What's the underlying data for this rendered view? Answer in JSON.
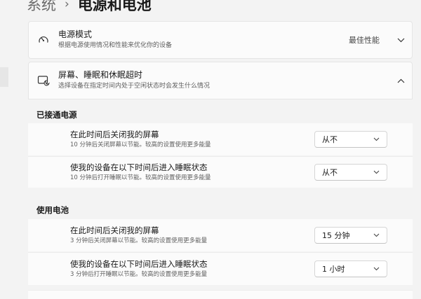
{
  "breadcrumb": {
    "parent": "系统",
    "separator": "›",
    "current": "电源和电池"
  },
  "power_mode": {
    "icon": "power-mode-gauge-icon",
    "title": "电源模式",
    "subtitle": "根据电源使用情况和性能来优化你的设备",
    "value": "最佳性能",
    "expanded": false
  },
  "screen_sleep": {
    "icon": "screen-sleep-icon",
    "title": "屏幕、睡眠和休眠超时",
    "subtitle": "选择设备在指定时间内处于空闲状态时会发生什么情况",
    "expanded": true,
    "plugged_in": {
      "label": "已接通电源",
      "screen_off": {
        "title": "在此时间后关闭我的屏幕",
        "subtitle": "10 分钟后关闭屏幕以节能。较高的设置使用更多能量",
        "value": "从不"
      },
      "sleep": {
        "title": "使我的设备在以下时间后进入睡眠状态",
        "subtitle": "10 分钟后打开睡眠以节能。较高的设置使用更多能量",
        "value": "从不"
      }
    },
    "on_battery": {
      "label": "使用电池",
      "screen_off": {
        "title": "在此时间后关闭我的屏幕",
        "subtitle": "3 分钟后关闭屏幕以节能。较高的设置使用更多能量",
        "value": "15 分钟"
      },
      "sleep": {
        "title": "使我的设备在以下时间后进入睡眠状态",
        "subtitle": "3 分钟后打开睡眠以节能。较高的设置使用更多能量",
        "value": "1 小时"
      }
    }
  },
  "colors": {
    "background": "#f3f3f3",
    "card": "#fbfbfb",
    "text_primary": "#1a1a1a",
    "text_secondary": "#5f5f5f"
  }
}
